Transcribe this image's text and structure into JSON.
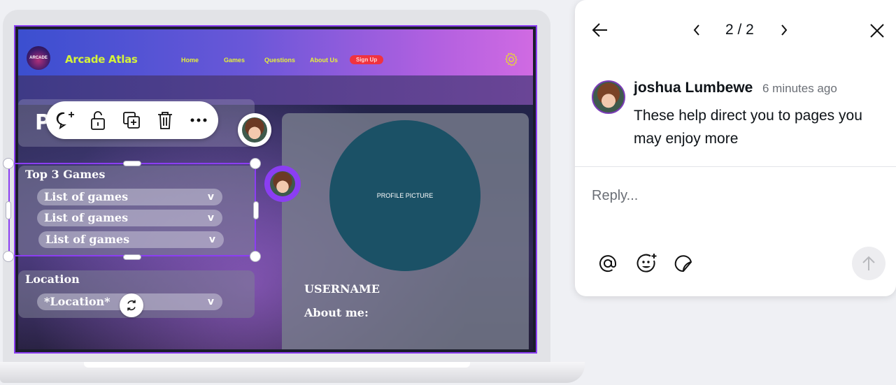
{
  "site": {
    "logo_text": "ARCADE",
    "brand": "Arcade Atlas",
    "nav": [
      "Home",
      "Games",
      "Questions",
      "About Us"
    ],
    "signup": "Sign Up",
    "page_letter": "P",
    "top_games": {
      "title": "Top 3 Games",
      "items": [
        "List of games",
        "List of games",
        "List of games"
      ],
      "caret": "v"
    },
    "location": {
      "title": "Location",
      "value": "*Location*",
      "caret": "v"
    },
    "profile": {
      "picture_label": "PROFILE PICTURE",
      "username": "USERNAME",
      "about": "About me:"
    }
  },
  "toolbar": {
    "icons": [
      "add-comment-icon",
      "lock-icon",
      "duplicate-icon",
      "trash-icon",
      "more-icon"
    ]
  },
  "comments": {
    "pager": "2 / 2",
    "author": "joshua Lumbewe",
    "time": "6 minutes ago",
    "body": "These help direct you to pages you may enjoy more",
    "reply_placeholder": "Reply...",
    "actions": [
      "mention-icon",
      "emoji-icon",
      "sticker-icon"
    ]
  },
  "colors": {
    "accent": "#8b3ef2",
    "brand_text": "#d4f23a",
    "signup_bg": "#f1333f",
    "profile_pic_bg": "#1b5166"
  }
}
